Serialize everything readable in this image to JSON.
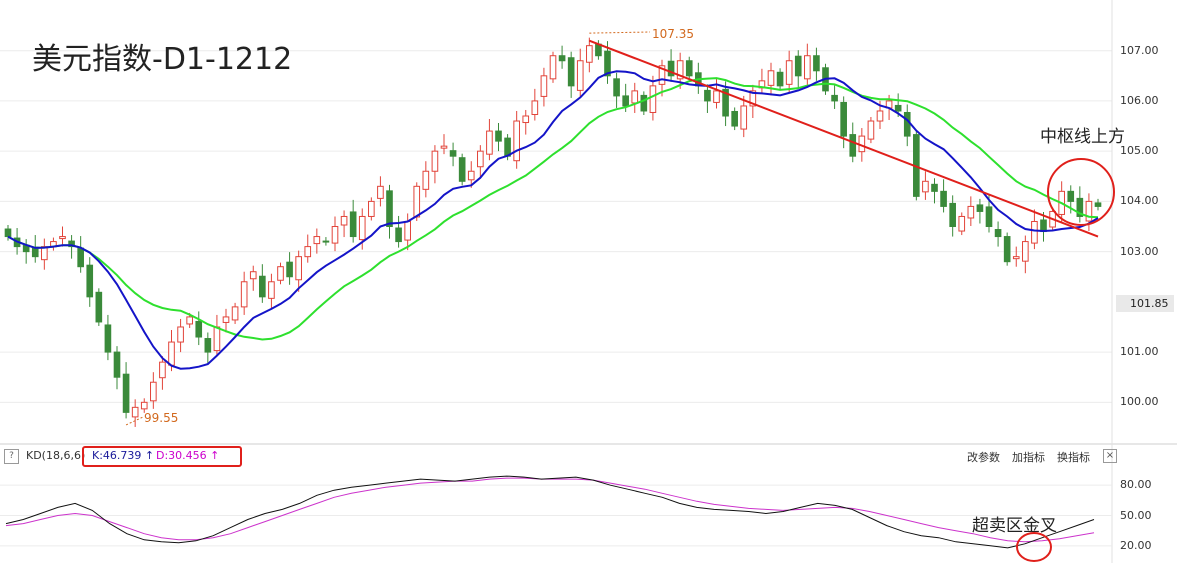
{
  "title": "美元指数-D1-1212",
  "annotations": {
    "above_zhongshu": "中枢线上方",
    "oversold_golden_cross": "超卖区金叉",
    "high_price": "107.35",
    "low_price": "99.55"
  },
  "kd_bar": {
    "help_icon": "?",
    "indicator_name": "KD(18,6,6)",
    "k_value": "K:46.739",
    "d_value": "D:30.456",
    "arrow": "↑",
    "buttons": [
      "改参数",
      "加指标",
      "换指标"
    ],
    "close_icon": "×"
  },
  "colors": {
    "up_candle": "#e2443a",
    "down_candle": "#3a8a3a",
    "ma_fast": "#1414c8",
    "ma_slow": "#2ee02e",
    "trendline": "#e0201b",
    "k_line": "#111111",
    "d_line": "#cc33cc",
    "circle": "#e0201b",
    "annotation_orange": "#d2691e"
  },
  "chart_data": [
    {
      "type": "candlestick",
      "title": "美元指数-D1-1212",
      "y_ticks": [
        "107.00",
        "106.00",
        "105.00",
        "104.00",
        "103.00",
        "101.85",
        "101.00",
        "100.00"
      ],
      "y_tick_values": [
        107.0,
        106.0,
        105.0,
        104.0,
        103.0,
        101.85,
        101.0,
        100.0
      ],
      "current_price": "101.85",
      "ylim": [
        99.25,
        107.85
      ],
      "close": [
        103.3,
        103.1,
        103.0,
        102.9,
        103.1,
        103.2,
        103.3,
        103.1,
        102.7,
        102.1,
        101.6,
        101.0,
        100.5,
        99.8,
        99.9,
        100.0,
        100.4,
        100.8,
        101.2,
        101.5,
        101.7,
        101.3,
        101.0,
        101.5,
        101.7,
        101.9,
        102.4,
        102.6,
        102.1,
        102.4,
        102.7,
        102.5,
        102.9,
        103.1,
        103.3,
        103.2,
        103.5,
        103.7,
        103.3,
        103.7,
        104.0,
        104.3,
        103.5,
        103.2,
        103.6,
        104.3,
        104.6,
        105.0,
        105.1,
        104.9,
        104.4,
        104.6,
        105.0,
        105.4,
        105.2,
        104.9,
        105.6,
        105.7,
        106.0,
        106.5,
        106.9,
        106.8,
        106.3,
        106.8,
        107.1,
        106.9,
        106.5,
        106.1,
        105.9,
        106.2,
        105.8,
        106.3,
        106.7,
        106.5,
        106.8,
        106.5,
        106.3,
        106.0,
        106.2,
        105.7,
        105.5,
        105.9,
        106.2,
        106.4,
        106.6,
        106.3,
        106.8,
        106.5,
        106.9,
        106.6,
        106.2,
        106.0,
        105.3,
        104.9,
        105.3,
        105.6,
        105.8,
        106.0,
        105.8,
        105.3,
        104.1,
        104.4,
        104.2,
        103.9,
        103.5,
        103.7,
        103.9,
        103.8,
        103.5,
        103.3,
        102.8,
        102.9,
        103.2,
        103.6,
        103.4,
        103.8,
        104.2,
        104.0,
        103.7,
        104.0,
        103.9
      ]
    },
    {
      "type": "line",
      "title": "KD(18,6,6)",
      "y_ticks": [
        "80.00",
        "50.00",
        "20.00"
      ],
      "y_tick_values": [
        80,
        50,
        20
      ],
      "ylim": [
        5,
        95
      ],
      "series": [
        {
          "name": "K:46.739",
          "values": [
            42,
            46,
            52,
            58,
            62,
            55,
            42,
            32,
            26,
            24,
            23,
            25,
            30,
            38,
            46,
            52,
            56,
            62,
            70,
            75,
            78,
            80,
            82,
            84,
            86,
            85,
            84,
            86,
            88,
            89,
            88,
            86,
            87,
            88,
            85,
            80,
            76,
            72,
            68,
            62,
            58,
            56,
            55,
            54,
            52,
            54,
            58,
            62,
            60,
            56,
            48,
            40,
            34,
            30,
            28,
            24,
            22,
            20,
            18,
            22,
            28,
            34,
            40,
            46
          ]
        },
        {
          "name": "D:30.456",
          "values": [
            40,
            42,
            46,
            50,
            52,
            50,
            44,
            38,
            32,
            28,
            26,
            26,
            28,
            32,
            38,
            44,
            50,
            56,
            62,
            68,
            72,
            75,
            78,
            80,
            82,
            83,
            84,
            84,
            86,
            87,
            87,
            86,
            86,
            86,
            85,
            82,
            79,
            76,
            72,
            68,
            64,
            61,
            59,
            57,
            56,
            55,
            56,
            57,
            58,
            57,
            54,
            50,
            46,
            42,
            38,
            35,
            32,
            28,
            25,
            24,
            25,
            27,
            30,
            33
          ]
        }
      ],
      "arrow_annotation": "↑"
    }
  ]
}
